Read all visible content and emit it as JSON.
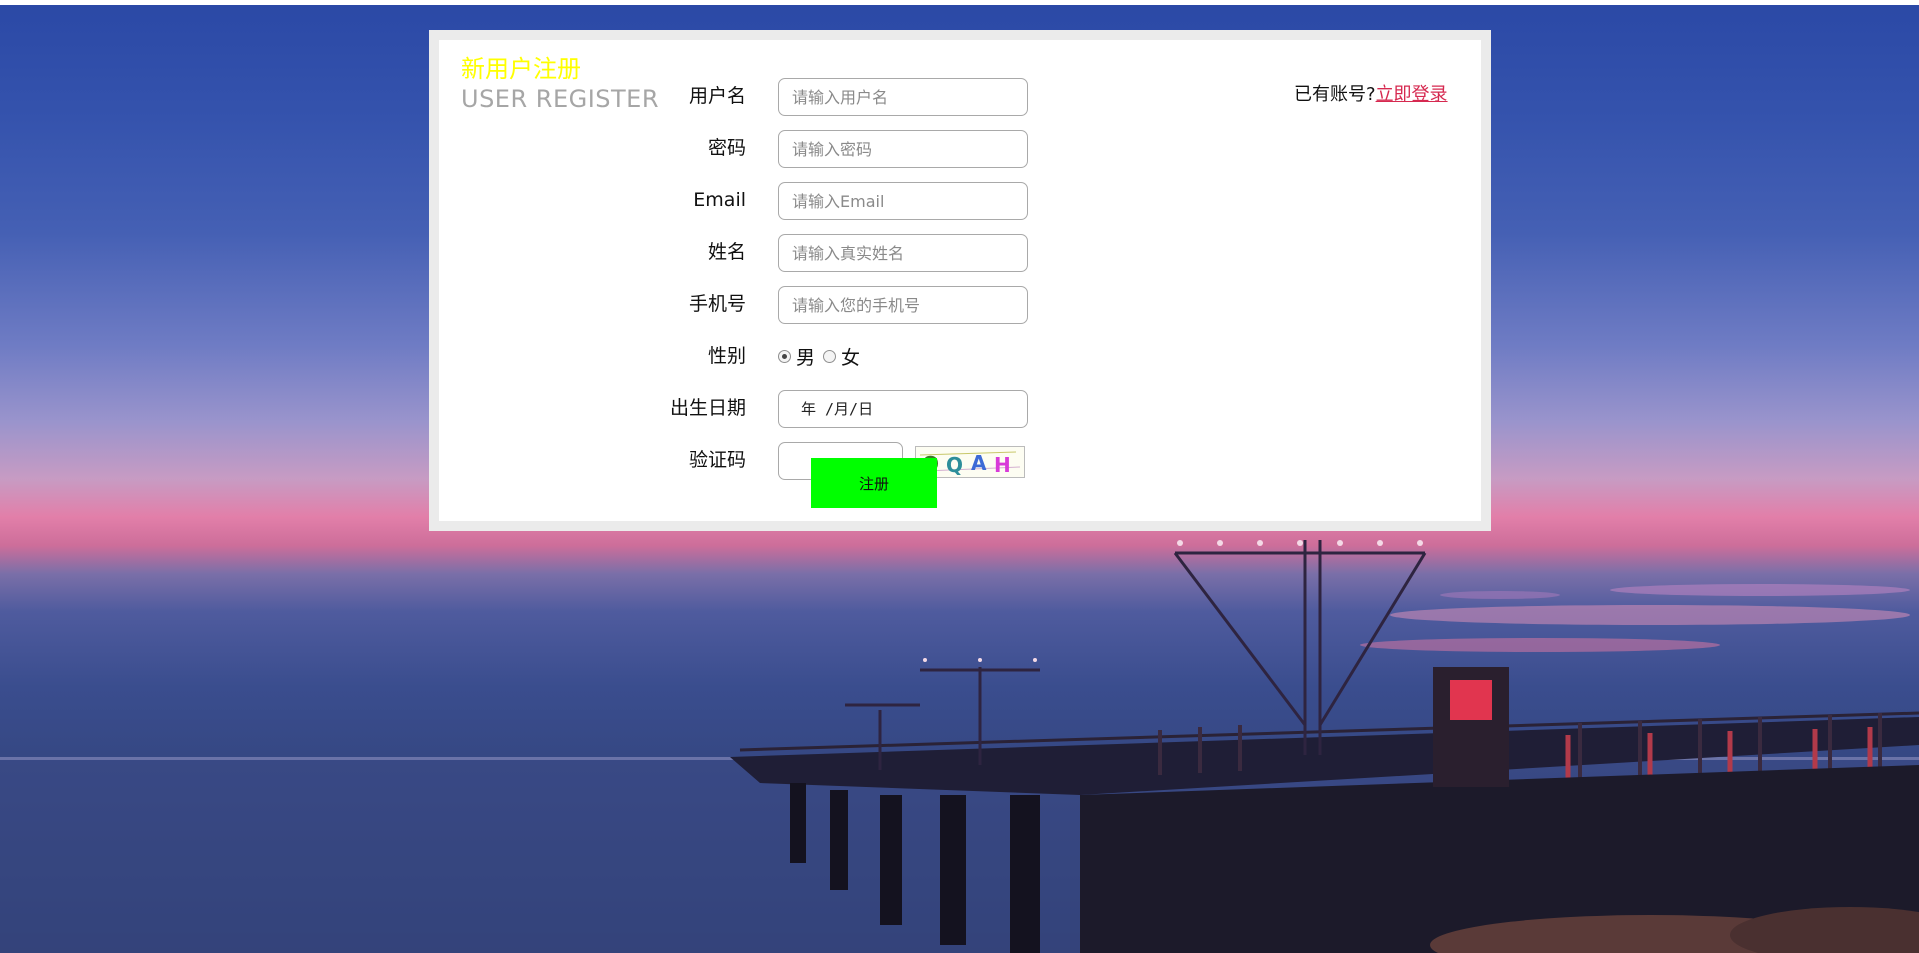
{
  "form": {
    "title_cn": "新用户注册",
    "title_en": "USER REGISTER",
    "login_prompt": "已有账号?",
    "login_link": "立即登录",
    "fields": {
      "username": {
        "label": "用户名",
        "placeholder": "请输入用户名"
      },
      "password": {
        "label": "密码",
        "placeholder": "请输入密码"
      },
      "email": {
        "label": "Email",
        "placeholder": "请输入Email"
      },
      "name": {
        "label": "姓名",
        "placeholder": "请输入真实姓名"
      },
      "phone": {
        "label": "手机号",
        "placeholder": "请输入您的手机号"
      },
      "gender": {
        "label": "性别",
        "option_male": "男",
        "option_female": "女",
        "selected": "男"
      },
      "birthday": {
        "label": "出生日期",
        "value": "年 /月/日"
      },
      "captcha": {
        "label": "验证码",
        "code": "QQAH"
      }
    },
    "submit_label": "注册"
  },
  "colors": {
    "title_cn": "#ffff00",
    "title_en": "#a6a6a6",
    "login_link": "#d62950",
    "submit_bg": "#00ff00",
    "panel_border": "#ebebeb"
  },
  "icons": {
    "background": "sunset-pier-photo",
    "captcha": "captcha-image"
  }
}
